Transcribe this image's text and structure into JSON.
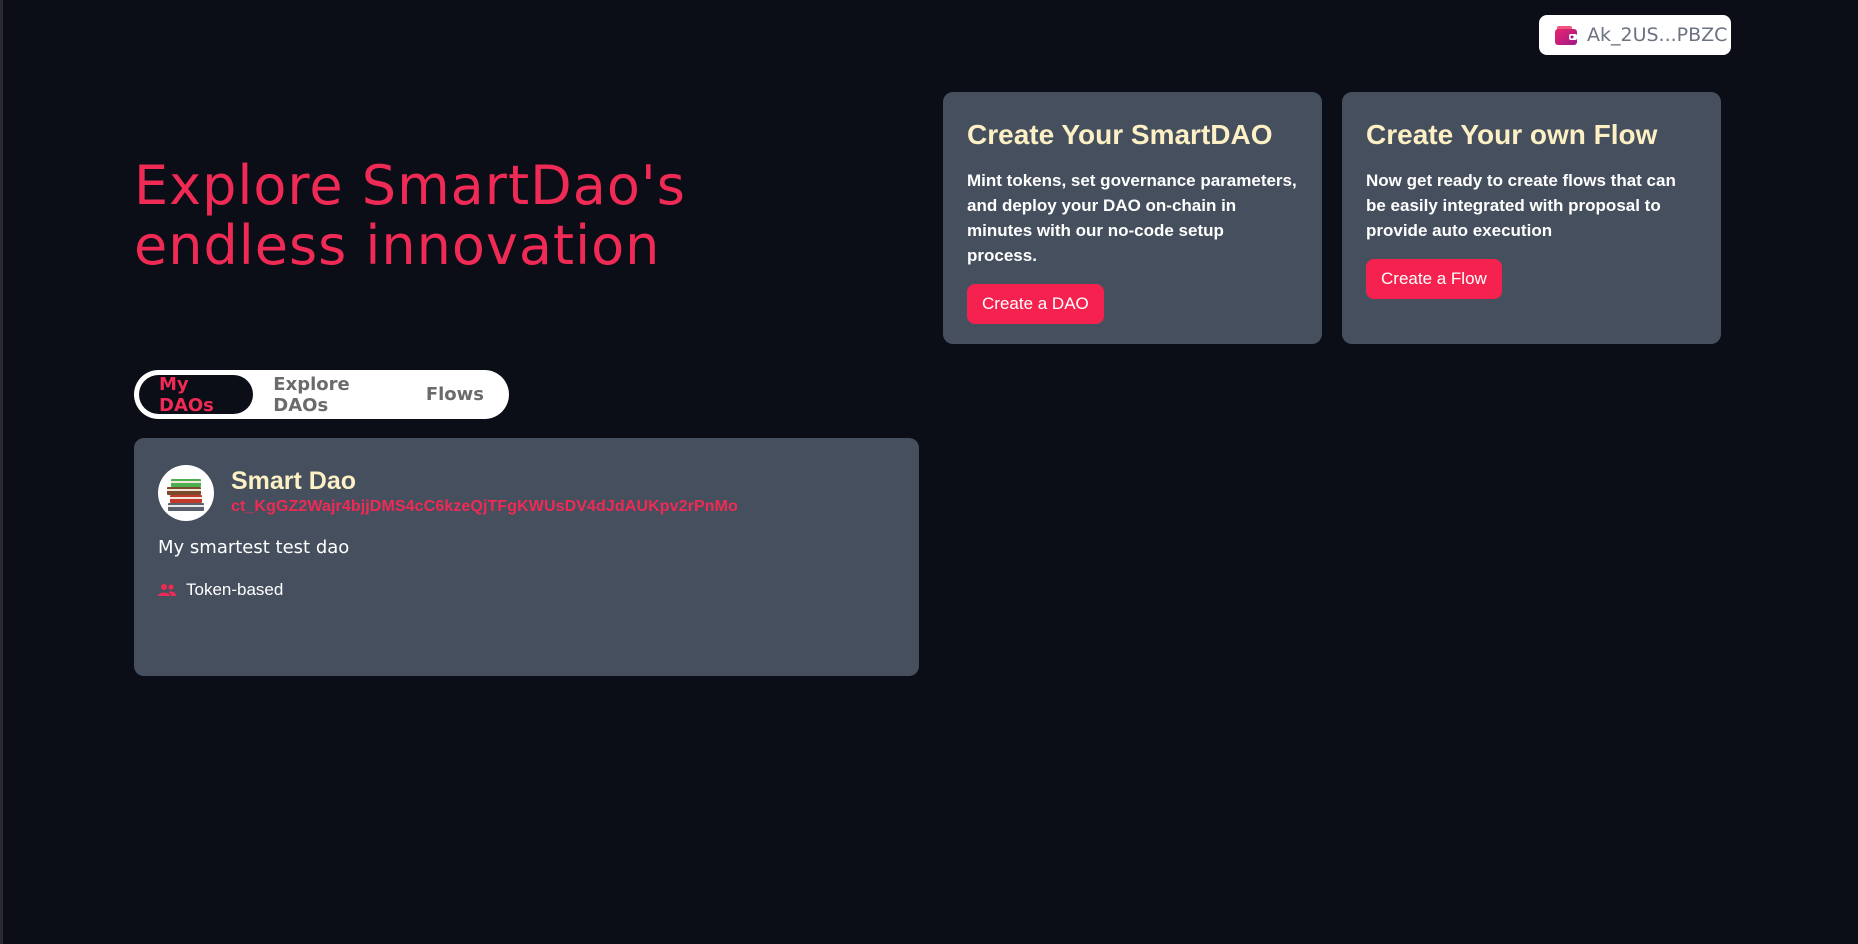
{
  "wallet": {
    "address": "Ak_2US...PBZC",
    "icon": "wallet-icon"
  },
  "hero": {
    "title_line1": "Explore SmartDao's",
    "title_line2": "endless innovation"
  },
  "promo_cards": [
    {
      "title": "Create Your SmartDAO",
      "description": "Mint tokens, set governance parameters, and deploy your DAO on-chain in minutes with our no-code setup process.",
      "button_label": "Create a DAO"
    },
    {
      "title": "Create Your own Flow",
      "description": "Now get ready to create flows that can be easily integrated with proposal to provide auto execution",
      "button_label": "Create a Flow"
    }
  ],
  "tabs": [
    {
      "label": "My DAOs",
      "active": true
    },
    {
      "label": "Explore DAOs",
      "active": false
    },
    {
      "label": "Flows",
      "active": false
    }
  ],
  "dao_list": [
    {
      "name": "Smart Dao",
      "address": "ct_KgGZ2Wajr4bjjDMS4cC6kzeQjTFgKWUsDV4dJdAUKpv2rPnMo",
      "description": "My smartest test dao",
      "type": "Token-based",
      "avatar": "books-icon"
    }
  ],
  "colors": {
    "background": "#0b0d17",
    "accent": "#ef2a55",
    "card": "#454f5d",
    "card_title": "#fdf0c4"
  }
}
